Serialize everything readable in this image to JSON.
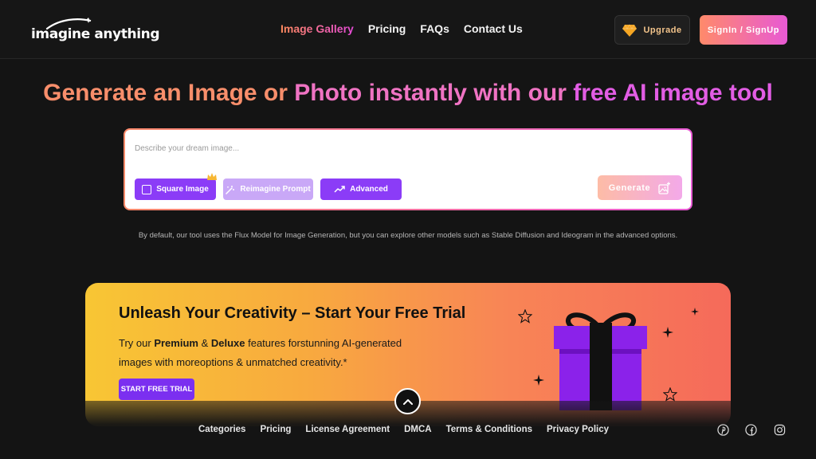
{
  "header": {
    "logo_text": "imagine anything",
    "nav": [
      {
        "label": "Image Gallery",
        "active": true
      },
      {
        "label": "Pricing",
        "active": false
      },
      {
        "label": "FAQs",
        "active": false
      },
      {
        "label": "Contact Us",
        "active": false
      }
    ],
    "upgrade_label": "Upgrade",
    "signin_label": "SignIn / SignUp"
  },
  "hero": {
    "title_part1": "Generate an Image or ",
    "title_part2": "Photo instantly with our ",
    "title_part3": "free AI image tool",
    "prompt_placeholder": "Describe your dream image...",
    "prompt_value": "",
    "square_label": "Square Image",
    "reimagine_label": "Reimagine Prompt",
    "advanced_label": "Advanced",
    "generate_label": "Generate",
    "info_text": "By default, our tool uses the Flux Model for Image Generation, but you can explore other models such as Stable Diffusion and Ideogram in the advanced options."
  },
  "promo": {
    "title": "Unleash Your Creativity – Start Your Free Trial",
    "desc_prefix": "Try our ",
    "desc_premium": "Premium",
    "desc_amp": " & ",
    "desc_deluxe": "Deluxe",
    "desc_rest": " features forstunning AI-generated images with moreoptions & unmatched creativity.*",
    "cta_label": "START FREE TRIAL"
  },
  "footer": {
    "links": [
      "Categories",
      "Pricing",
      "License Agreement",
      "DMCA",
      "Terms & Conditions",
      "Privacy Policy"
    ],
    "social": [
      "pinterest-icon",
      "facebook-icon",
      "instagram-icon"
    ]
  },
  "colors": {
    "accent_purple": "#8b3cf7",
    "gradient_start": "#ff8a6a",
    "gradient_end": "#e85ad4",
    "background": "#141414"
  }
}
